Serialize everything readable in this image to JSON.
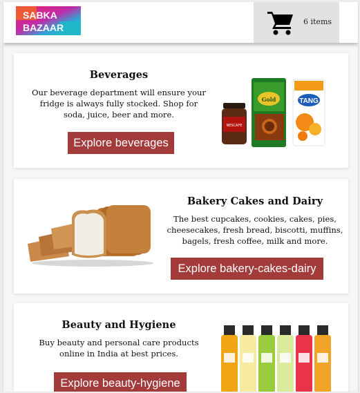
{
  "header": {
    "logo_line1": "SABKA",
    "logo_line2": "BAZAAR",
    "cart_icon": "cart-icon",
    "cart_count": "6 items"
  },
  "categories": [
    {
      "title": "Beverages",
      "description": "Our beverage department will ensure your fridge is always fully stocked. Shop for soda, juice, beer and more.",
      "button": "Explore beverages",
      "image": "beverages-products-image",
      "product_labels": [
        "NESCAFE",
        "TATA TEA Gold",
        "ORANGE TANG"
      ]
    },
    {
      "title": "Bakery Cakes and Dairy",
      "description": "The best cupcakes, cookies, cakes, pies, cheesecakes, fresh bread, biscotti, muffins, bagels, fresh coffee, milk and more.",
      "button": "Explore bakery-cakes-dairy",
      "image": "sliced-bread-image"
    },
    {
      "title": "Beauty and Hygiene",
      "description": "Buy beauty and personal care products online in India at best prices.",
      "button": "Explore beauty-hygiene",
      "image": "shower-gel-bottles-image"
    }
  ],
  "colors": {
    "button": "#a43b3b",
    "cart_bg": "#e2e2e2",
    "page_bg": "#f6f6f6"
  }
}
